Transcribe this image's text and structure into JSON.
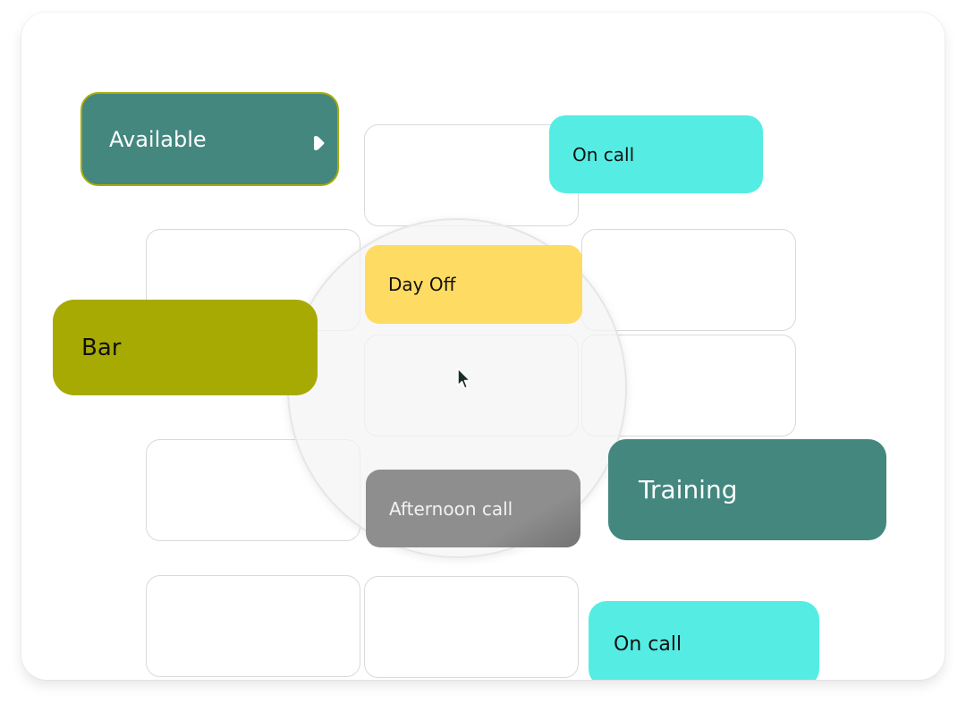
{
  "colors": {
    "teal": "#43877f",
    "olive": "#a8aa04",
    "aqua": "#55ede3",
    "yellow": "#fedb62",
    "gray": "#8e8e8e"
  },
  "chips": {
    "available": {
      "label": "Available",
      "icon": "play-icon"
    },
    "on_call_top": {
      "label": "On call"
    },
    "day_off": {
      "label": "Day Off"
    },
    "bar": {
      "label": "Bar"
    },
    "afternoon_call": {
      "label": "Afternoon call"
    },
    "training": {
      "label": "Training"
    },
    "on_call_bottom": {
      "label": "On call"
    }
  },
  "cursor": {
    "icon": "arrow-cursor-icon"
  }
}
